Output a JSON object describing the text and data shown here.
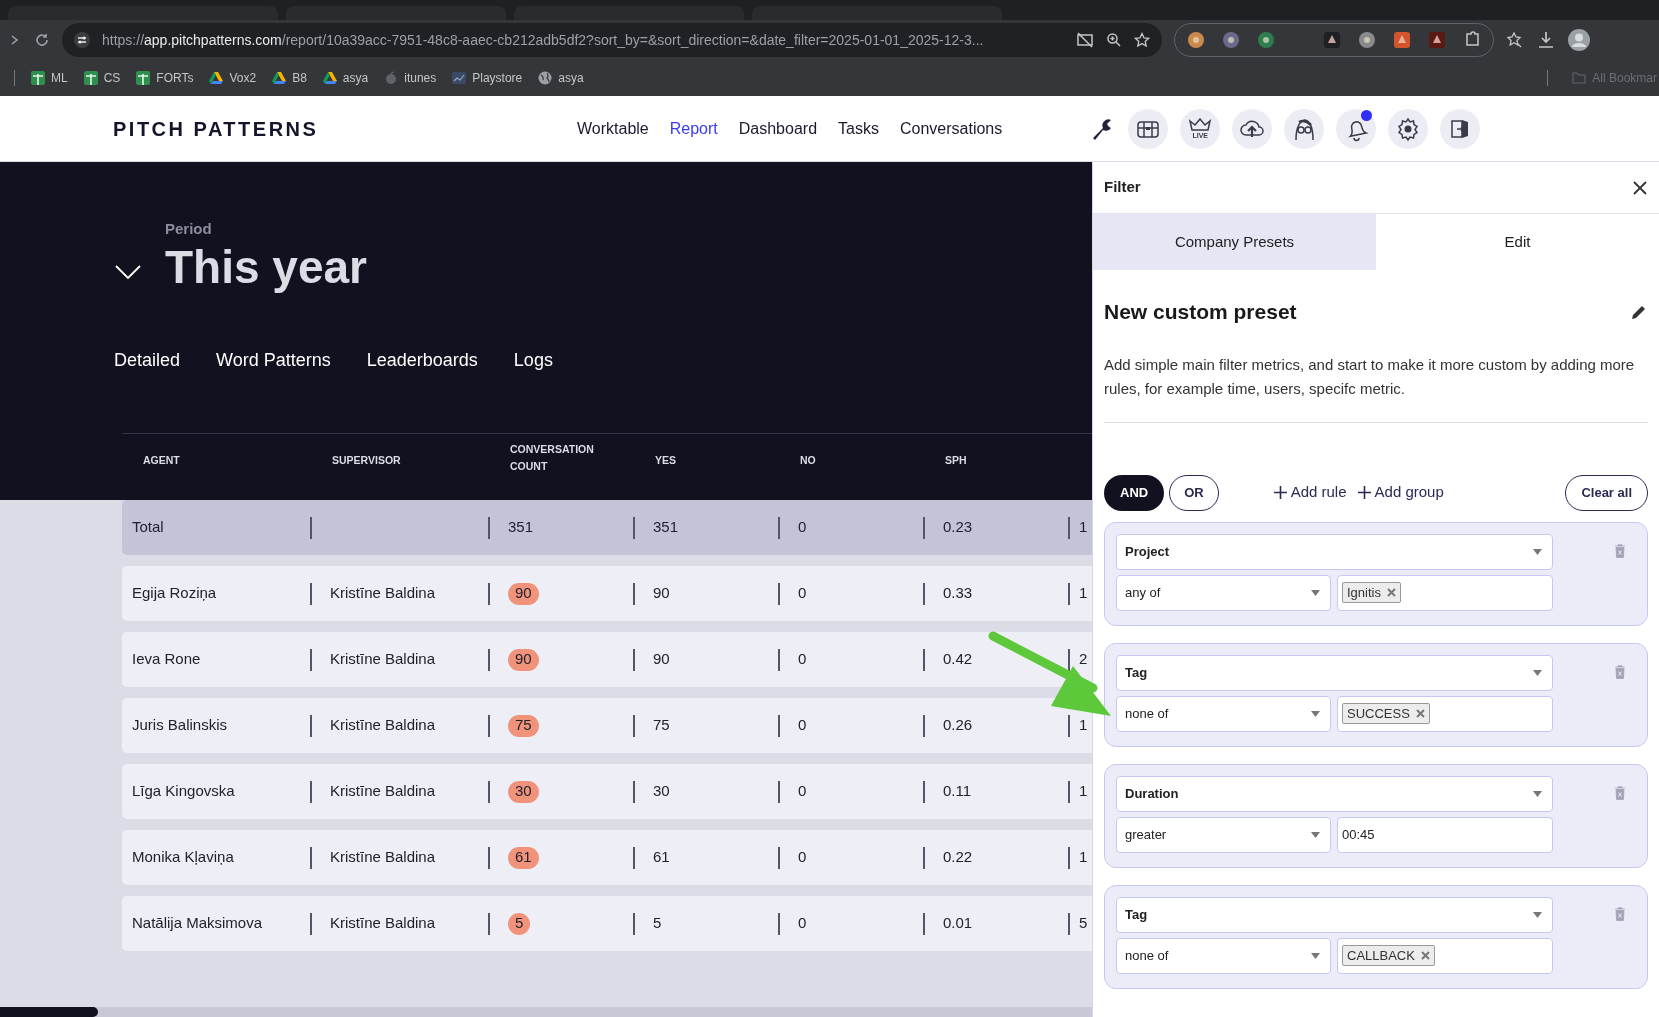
{
  "browser": {
    "url": {
      "scheme": "https://",
      "host": "app.pitchpatterns.com",
      "rest": "/report/10a39acc-7951-48c8-aaec-cb212adb5df2?sort_by=&sort_direction=&date_filter=2025-01-01_2025-12-3..."
    },
    "bookmarks": [
      {
        "label": "ML",
        "kind": "sheet"
      },
      {
        "label": "CS",
        "kind": "sheet"
      },
      {
        "label": "FORTs",
        "kind": "sheet"
      },
      {
        "label": "Vox2",
        "kind": "drive"
      },
      {
        "label": "B8",
        "kind": "drive"
      },
      {
        "label": "asya",
        "kind": "drive"
      },
      {
        "label": "itunes",
        "kind": "apple"
      },
      {
        "label": "Playstore",
        "kind": "chart"
      },
      {
        "label": "asya",
        "kind": "globe"
      }
    ],
    "all_bookmarks": "All Bookmar"
  },
  "app": {
    "logo": "PITCH PATTERNS",
    "nav": [
      {
        "label": "Worktable",
        "selected": false
      },
      {
        "label": "Report",
        "selected": true
      },
      {
        "label": "Dashboard",
        "selected": false
      },
      {
        "label": "Tasks",
        "selected": false
      },
      {
        "label": "Conversations",
        "selected": false
      }
    ],
    "live_label": "LIVE",
    "notification_dot": true
  },
  "report": {
    "period_label": "Period",
    "period": "This year",
    "expanded": false,
    "tabs": [
      {
        "label": "Detailed",
        "selected": false
      },
      {
        "label": "Word Patterns",
        "selected": false
      },
      {
        "label": "Leaderboards",
        "selected": false
      },
      {
        "label": "Logs",
        "selected": false
      }
    ],
    "table": {
      "columns": [
        "AGENT",
        "SUPERVISOR",
        "CONVERSATION COUNT",
        "YES",
        "NO",
        "SPH"
      ],
      "rows": [
        {
          "kind": "total",
          "cells": [
            "Total",
            "",
            "351",
            "351",
            "0",
            "0.23",
            "1"
          ]
        },
        {
          "kind": "agent",
          "cells": [
            "Egija Roziņa",
            "Kristīne Baldina",
            "90",
            "90",
            "0",
            "0.33",
            "1"
          ]
        },
        {
          "kind": "agent",
          "cells": [
            "Ieva Rone",
            "Kristīne Baldina",
            "90",
            "90",
            "0",
            "0.42",
            "2"
          ]
        },
        {
          "kind": "agent",
          "cells": [
            "Juris Balinskis",
            "Kristīne Baldina",
            "75",
            "75",
            "0",
            "0.26",
            "1"
          ]
        },
        {
          "kind": "agent",
          "cells": [
            "Līga Kingovska",
            "Kristīne Baldina",
            "30",
            "30",
            "0",
            "0.11",
            "1"
          ]
        },
        {
          "kind": "agent",
          "cells": [
            "Monika Kļaviņa",
            "Kristīne Baldina",
            "61",
            "61",
            "0",
            "0.22",
            "1"
          ]
        },
        {
          "kind": "agent",
          "cells": [
            "Natālija Maksimova",
            "Kristīne Baldina",
            "5",
            "5",
            "0",
            "0.01",
            "5"
          ]
        }
      ]
    }
  },
  "filter": {
    "title": "Filter",
    "tabs": [
      {
        "label": "Company Presets",
        "selected": true
      },
      {
        "label": "Edit",
        "selected": false
      }
    ],
    "preset_title": "New custom preset",
    "description": "Add simple main filter metrics, and start to make it more custom by adding more rules, for example time, users, specifc metric.",
    "logic": [
      {
        "label": "AND",
        "selected": true
      },
      {
        "label": "OR",
        "selected": false
      }
    ],
    "add_rule": "Add rule",
    "add_group": "Add group",
    "clear_all": "Clear all",
    "rules": [
      {
        "field": "Project",
        "operator": "any of",
        "tags": [
          "Ignitis"
        ]
      },
      {
        "field": "Tag",
        "operator": "none of",
        "tags": [
          "SUCCESS"
        ]
      },
      {
        "field": "Duration",
        "operator": "greater",
        "value": "00:45"
      },
      {
        "field": "Tag",
        "operator": "none of",
        "tags": [
          "CALLBACK"
        ]
      }
    ]
  }
}
